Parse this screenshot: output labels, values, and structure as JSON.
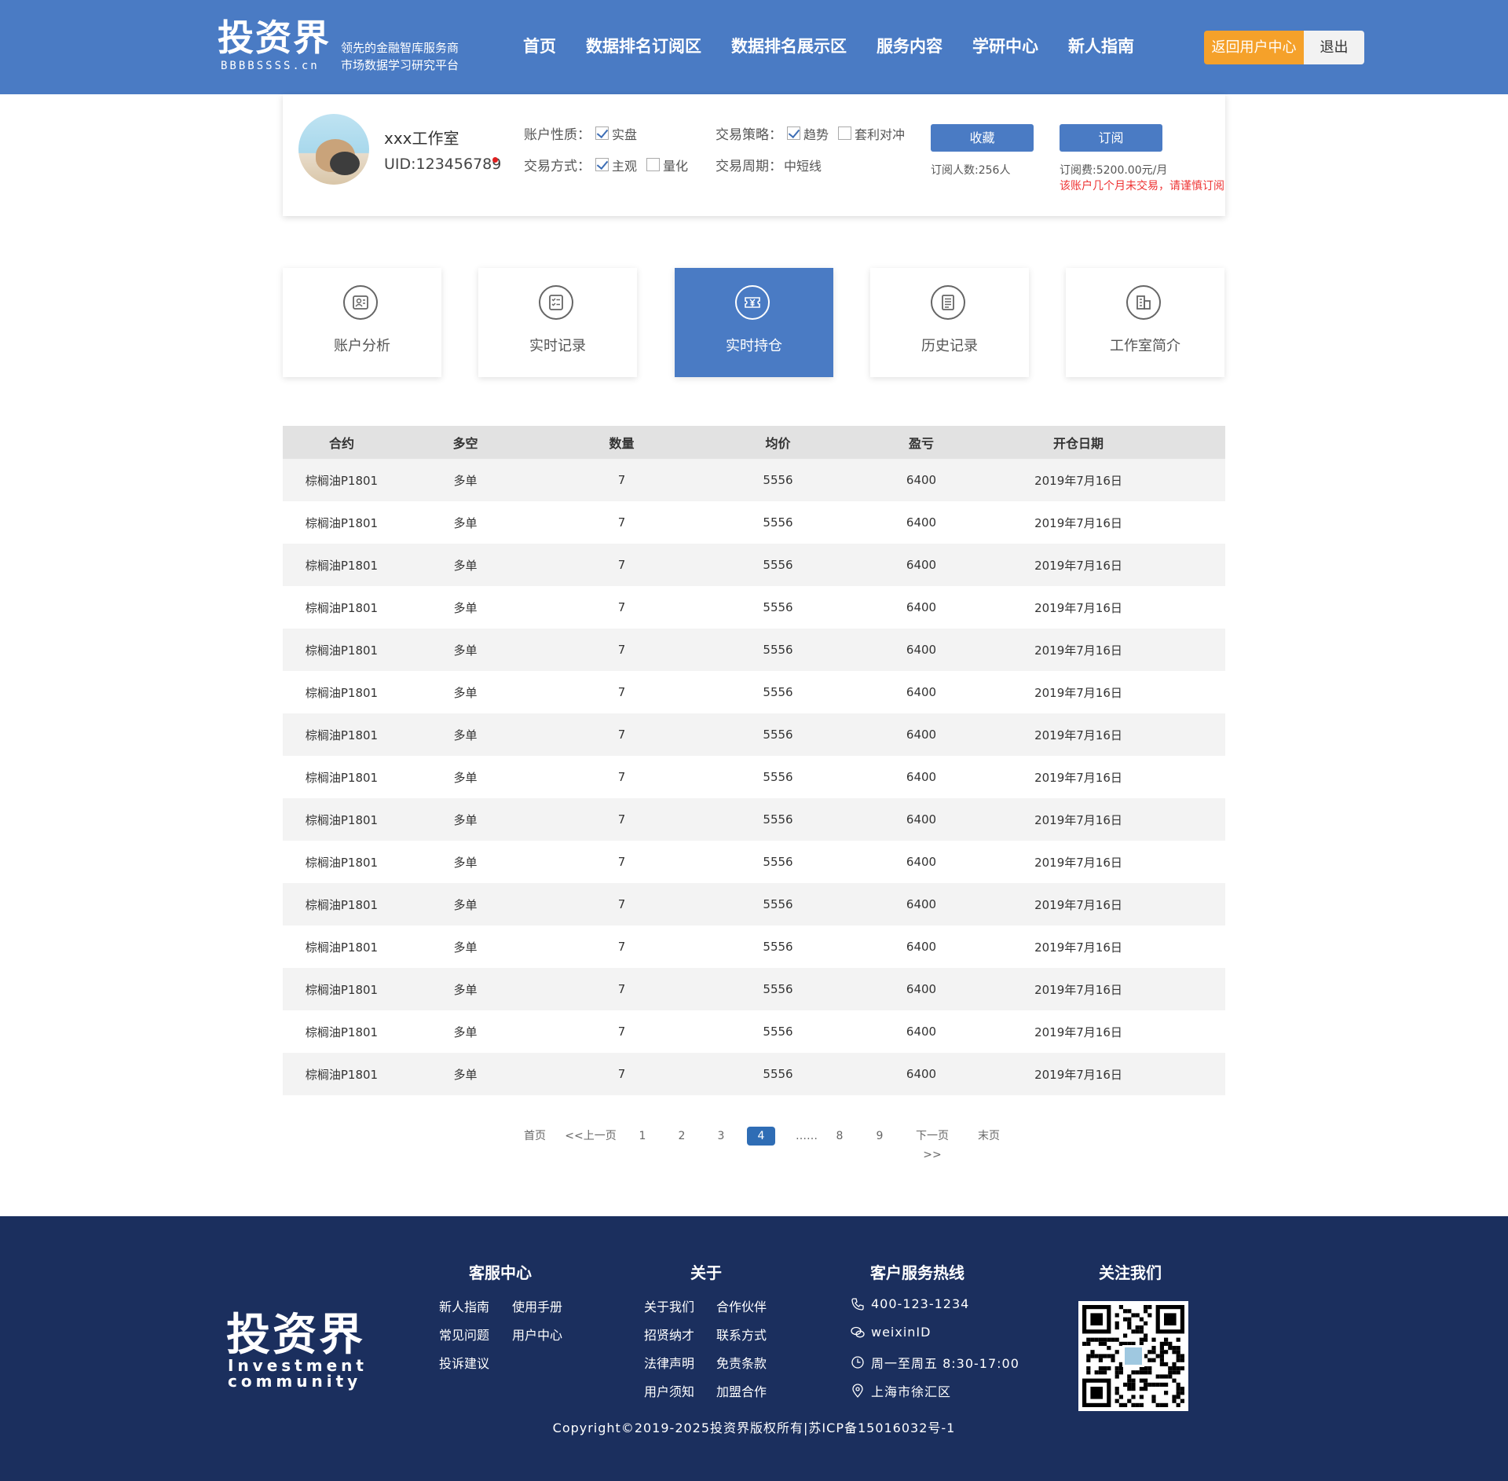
{
  "header": {
    "logo": "投资界",
    "logo_sub": "BBBBSSSS.cn",
    "slogan_line1": "领先的金融智库服务商",
    "slogan_line2": "市场数据学习研究平台",
    "nav": [
      "首页",
      "数据排名订阅区",
      "数据排名展示区",
      "服务内容",
      "学研中心",
      "新人指南"
    ],
    "return_btn": "返回用户中心",
    "logout_btn": "退出"
  },
  "profile": {
    "name": "xxx工作室",
    "uid": "UID:123456789",
    "account_type_label": "账户性质：",
    "account_type_opts": [
      {
        "label": "实盘",
        "checked": true
      }
    ],
    "trade_mode_label": "交易方式：",
    "trade_mode_opts": [
      {
        "label": "主观",
        "checked": true
      },
      {
        "label": "量化",
        "checked": false
      }
    ],
    "strategy_label": "交易策略：",
    "strategy_opts": [
      {
        "label": "趋势",
        "checked": true
      },
      {
        "label": "套利对冲",
        "checked": false
      }
    ],
    "cycle_label": "交易周期：",
    "cycle_value": "中短线",
    "fav_btn": "收藏",
    "sub_btn": "订阅",
    "sub_count": "订阅人数:256人",
    "sub_fee": "订阅费:5200.00元/月",
    "warning": "该账户几个月未交易，请谨慎订阅"
  },
  "tabs": [
    {
      "label": "账户分析",
      "icon": "id-card-icon",
      "active": false
    },
    {
      "label": "实时记录",
      "icon": "checklist-icon",
      "active": false
    },
    {
      "label": "实时持仓",
      "icon": "yuan-ticket-icon",
      "active": true
    },
    {
      "label": "历史记录",
      "icon": "document-icon",
      "active": false
    },
    {
      "label": "工作室简介",
      "icon": "building-icon",
      "active": false
    }
  ],
  "table": {
    "headers": [
      "合约",
      "多空",
      "数量",
      "均价",
      "盈亏",
      "开仓日期"
    ],
    "rows": [
      [
        "棕榈油P1801",
        "多单",
        "7",
        "5556",
        "6400",
        "2019年7月16日"
      ],
      [
        "棕榈油P1801",
        "多单",
        "7",
        "5556",
        "6400",
        "2019年7月16日"
      ],
      [
        "棕榈油P1801",
        "多单",
        "7",
        "5556",
        "6400",
        "2019年7月16日"
      ],
      [
        "棕榈油P1801",
        "多单",
        "7",
        "5556",
        "6400",
        "2019年7月16日"
      ],
      [
        "棕榈油P1801",
        "多单",
        "7",
        "5556",
        "6400",
        "2019年7月16日"
      ],
      [
        "棕榈油P1801",
        "多单",
        "7",
        "5556",
        "6400",
        "2019年7月16日"
      ],
      [
        "棕榈油P1801",
        "多单",
        "7",
        "5556",
        "6400",
        "2019年7月16日"
      ],
      [
        "棕榈油P1801",
        "多单",
        "7",
        "5556",
        "6400",
        "2019年7月16日"
      ],
      [
        "棕榈油P1801",
        "多单",
        "7",
        "5556",
        "6400",
        "2019年7月16日"
      ],
      [
        "棕榈油P1801",
        "多单",
        "7",
        "5556",
        "6400",
        "2019年7月16日"
      ],
      [
        "棕榈油P1801",
        "多单",
        "7",
        "5556",
        "6400",
        "2019年7月16日"
      ],
      [
        "棕榈油P1801",
        "多单",
        "7",
        "5556",
        "6400",
        "2019年7月16日"
      ],
      [
        "棕榈油P1801",
        "多单",
        "7",
        "5556",
        "6400",
        "2019年7月16日"
      ],
      [
        "棕榈油P1801",
        "多单",
        "7",
        "5556",
        "6400",
        "2019年7月16日"
      ],
      [
        "棕榈油P1801",
        "多单",
        "7",
        "5556",
        "6400",
        "2019年7月16日"
      ]
    ]
  },
  "pagination": {
    "first": "首页",
    "prev": "<<上一页",
    "pages": [
      "1",
      "2",
      "3",
      "4",
      "……",
      "8",
      "9"
    ],
    "current": "4",
    "next": "下一页>>",
    "last": "末页"
  },
  "footer": {
    "logo": "投资界",
    "logo_en_1": "Investment",
    "logo_en_2": "community",
    "service_title": "客服中心",
    "service_links": [
      "新人指南",
      "使用手册",
      "常见问题",
      "用户中心",
      "投诉建议"
    ],
    "about_title": "关于",
    "about_links": [
      "关于我们",
      "合作伙伴",
      "招贤纳才",
      "联系方式",
      "法律声明",
      "免责条款",
      "用户须知",
      "加盟合作"
    ],
    "hotline_title": "客户服务热线",
    "phone": "400-123-1234",
    "wechat": "weixinID",
    "hours": "周一至周五 8:30-17:00",
    "address": "上海市徐汇区",
    "follow_title": "关注我们",
    "copyright": "Copyright©2019-2025投资界版权所有|苏ICP备15016032号-1"
  },
  "colors": {
    "primary": "#4a7bc4",
    "accent": "#f5a12a",
    "footer_bg": "#1b2f5e",
    "warning": "#e33333"
  }
}
